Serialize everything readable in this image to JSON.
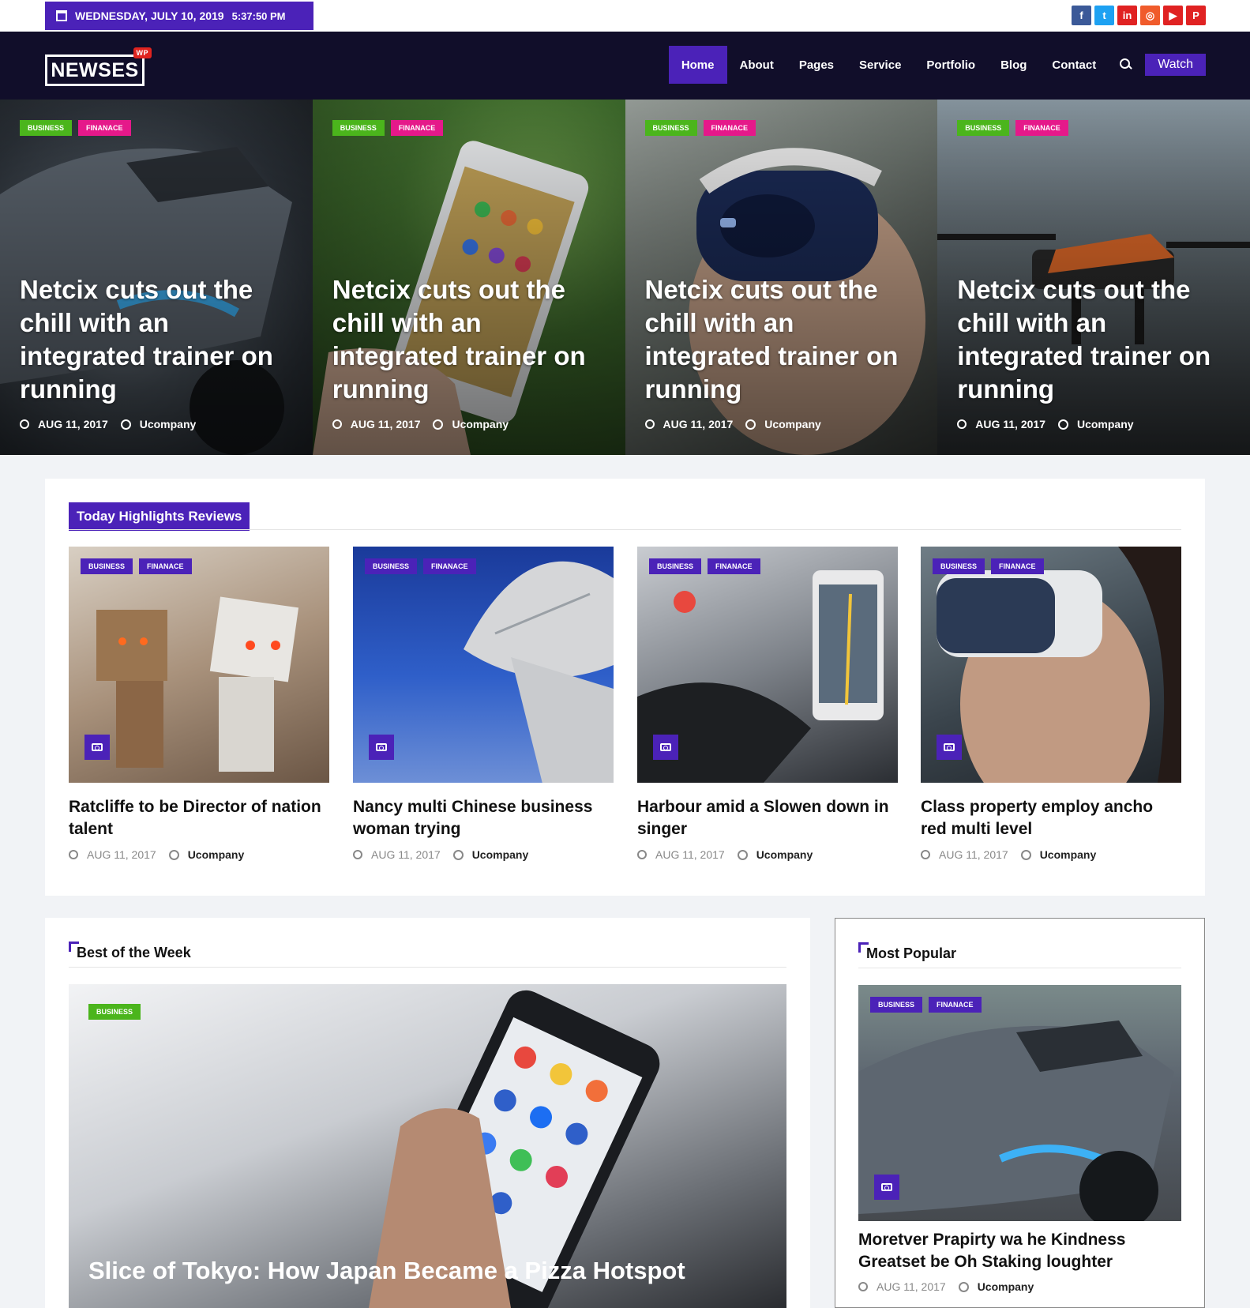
{
  "topbar": {
    "date": "WEDNESDAY, JULY 10, 2019",
    "time": "5:37:50 PM",
    "social": [
      {
        "name": "facebook",
        "glyph": "f",
        "color": "#3b5998"
      },
      {
        "name": "twitter",
        "glyph": "t",
        "color": "#1da1f2"
      },
      {
        "name": "linkedin",
        "glyph": "in",
        "color": "#e02222"
      },
      {
        "name": "instagram",
        "glyph": "◎",
        "color": "#f05b2b"
      },
      {
        "name": "youtube",
        "glyph": "▶",
        "color": "#e02222"
      },
      {
        "name": "pinterest",
        "glyph": "P",
        "color": "#e02222"
      }
    ]
  },
  "nav": {
    "logo": "NEWSES",
    "logo_badge": "WP",
    "items": [
      "Home",
      "About",
      "Pages",
      "Service",
      "Portfolio",
      "Blog",
      "Contact"
    ],
    "watch_label": "Watch"
  },
  "tags": {
    "business": "BUSINESS",
    "finance": "FINANACE"
  },
  "hero": [
    {
      "title": "Netcix cuts out the chill with an integrated trainer on running",
      "date": "AUG 11, 2017",
      "author": "Ucompany"
    },
    {
      "title": "Netcix cuts out the chill with an integrated trainer on running",
      "date": "AUG 11, 2017",
      "author": "Ucompany"
    },
    {
      "title": "Netcix cuts out the chill with an integrated trainer on running",
      "date": "AUG 11, 2017",
      "author": "Ucompany"
    },
    {
      "title": "Netcix cuts out the chill with an integrated trainer on running",
      "date": "AUG 11, 2017",
      "author": "Ucompany"
    }
  ],
  "highlights": {
    "heading": "Today Highlights Reviews",
    "cards": [
      {
        "title": "Ratcliffe to be Director of nation talent",
        "date": "AUG 11, 2017",
        "author": "Ucompany"
      },
      {
        "title": "Nancy multi Chinese business woman trying",
        "date": "AUG 11, 2017",
        "author": "Ucompany"
      },
      {
        "title": "Harbour amid a Slowen down in singer",
        "date": "AUG 11, 2017",
        "author": "Ucompany"
      },
      {
        "title": "Class property employ ancho red multi level",
        "date": "AUG 11, 2017",
        "author": "Ucompany"
      }
    ]
  },
  "best": {
    "heading": "Best of the Week",
    "tag": "BUSINESS",
    "title": "Slice of Tokyo: How Japan Became a Pizza Hotspot"
  },
  "popular": {
    "heading": "Most Popular",
    "title": "Moretver Prapirty wa he Kindness Greatset be Oh Staking loughter",
    "date": "AUG 11, 2017",
    "author": "Ucompany"
  },
  "colors": {
    "accent": "#4b22b8",
    "nav_bg": "#110e2a",
    "tag_green": "#4bb51c",
    "tag_pink": "#e5198a"
  }
}
